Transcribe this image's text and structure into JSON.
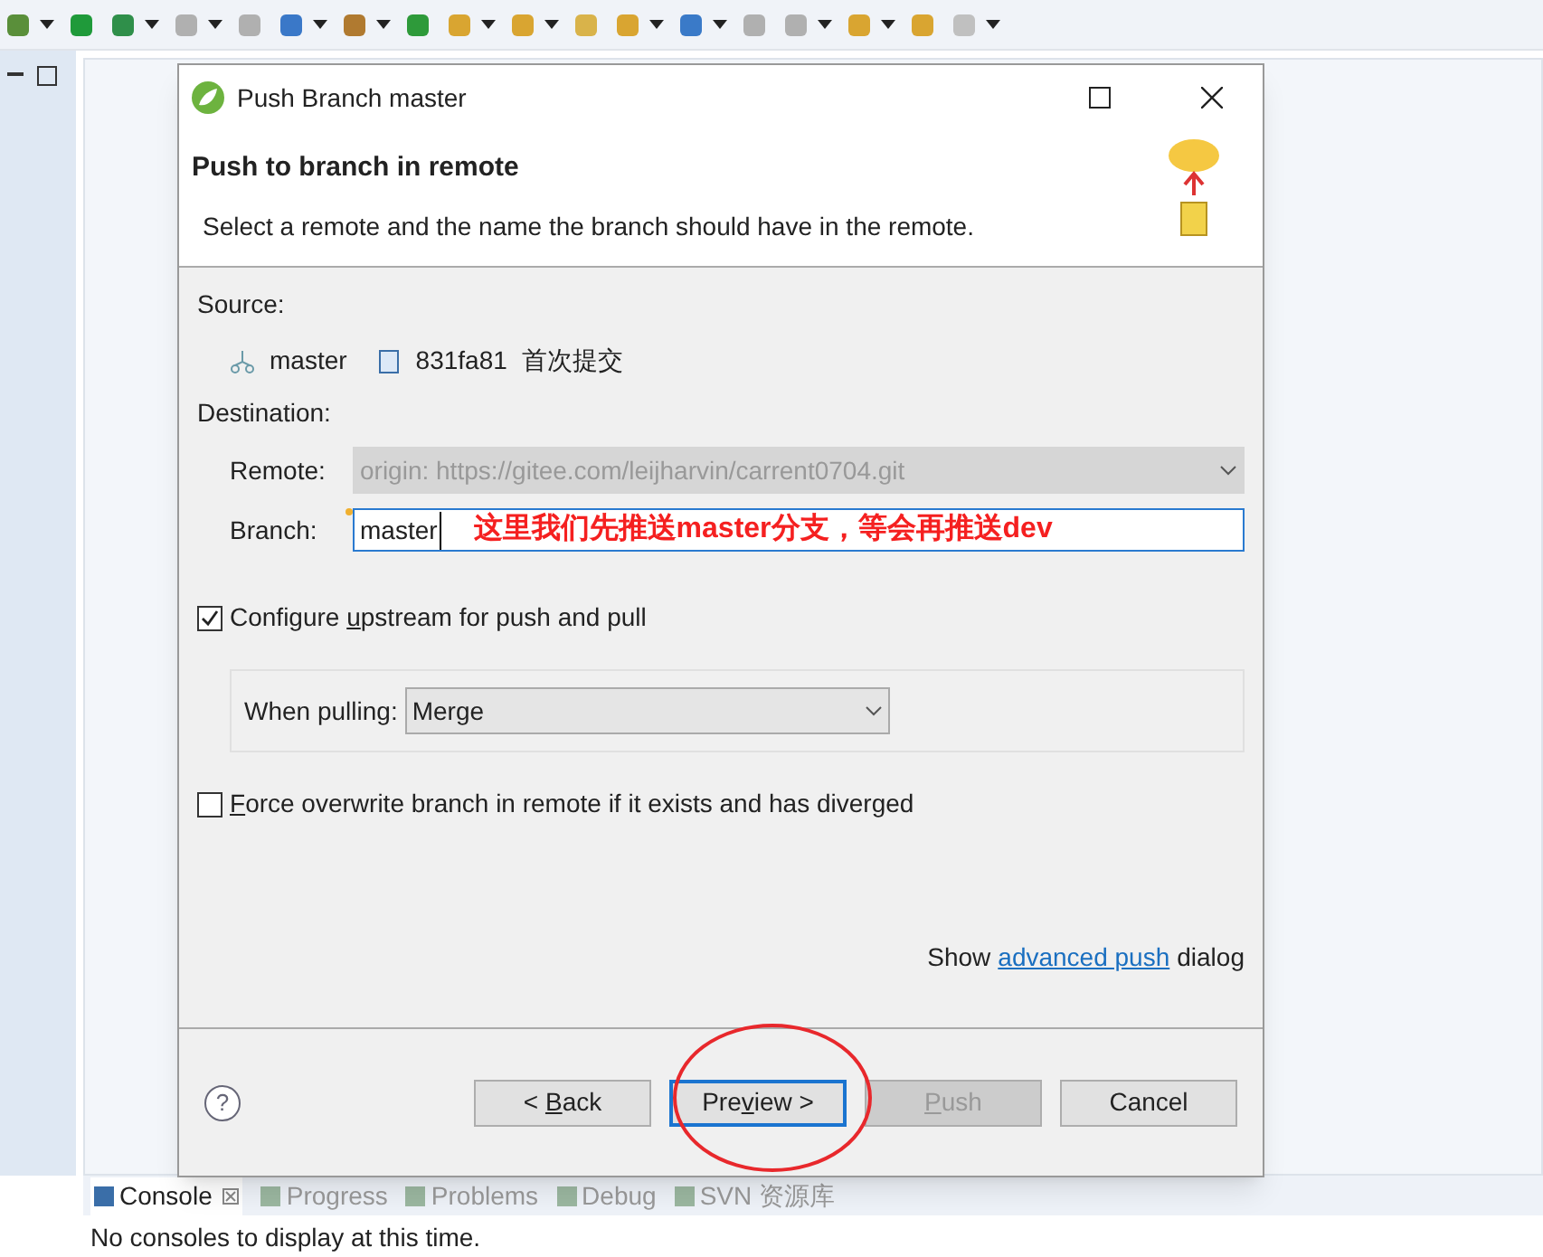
{
  "dialog": {
    "title": "Push Branch master",
    "header": {
      "title": "Push to branch in remote",
      "description": "Select a remote and the name the branch should have in the remote."
    },
    "source": {
      "label": "Source:",
      "branch": "master",
      "commit": "831fa81",
      "message": "首次提交"
    },
    "destination": {
      "label": "Destination:",
      "remote": {
        "label": "Remote:",
        "value": "origin: https://gitee.com/leijharvin/carrent0704.git",
        "disabled": true
      },
      "branch": {
        "label": "Branch:",
        "value": "master",
        "annotation": "这里我们先推送master分支，等会再推送dev"
      }
    },
    "options": [
      {
        "kind": "checkbox",
        "label": {
          "before": "Configure ",
          "key": "u",
          "after": "pstream for push and pull"
        },
        "checked": true
      },
      {
        "kind": "select",
        "label": "When pulling:",
        "value": "Merge"
      },
      {
        "kind": "checkbox",
        "label": {
          "key": "F",
          "after": "orce overwrite branch in remote if it exists and has diverged"
        },
        "checked": false
      }
    ],
    "advanced": {
      "before": "Show",
      "link": "advanced push",
      "after": "dialog"
    },
    "help": "?",
    "buttons": [
      {
        "label": {
          "before": "< ",
          "key": "B",
          "after": "ack"
        },
        "disabled": false,
        "selected": false
      },
      {
        "label": {
          "before": "Pre",
          "key": "v",
          "after": "iew >"
        },
        "disabled": false,
        "selected": true
      },
      {
        "label": {
          "key": "P",
          "after": "ush"
        },
        "disabled": true,
        "selected": false
      },
      {
        "label": {
          "before": "Cancel"
        },
        "disabled": false,
        "selected": false
      }
    ]
  },
  "console": {
    "tabs": [
      {
        "label": "Console",
        "selected": true
      },
      {
        "label": "Progress",
        "selected": false
      },
      {
        "label": "Problems",
        "selected": false
      },
      {
        "label": "Debug",
        "selected": false
      },
      {
        "label": "SVN 资源库",
        "selected": false
      }
    ],
    "message": "No consoles to display at this time."
  }
}
